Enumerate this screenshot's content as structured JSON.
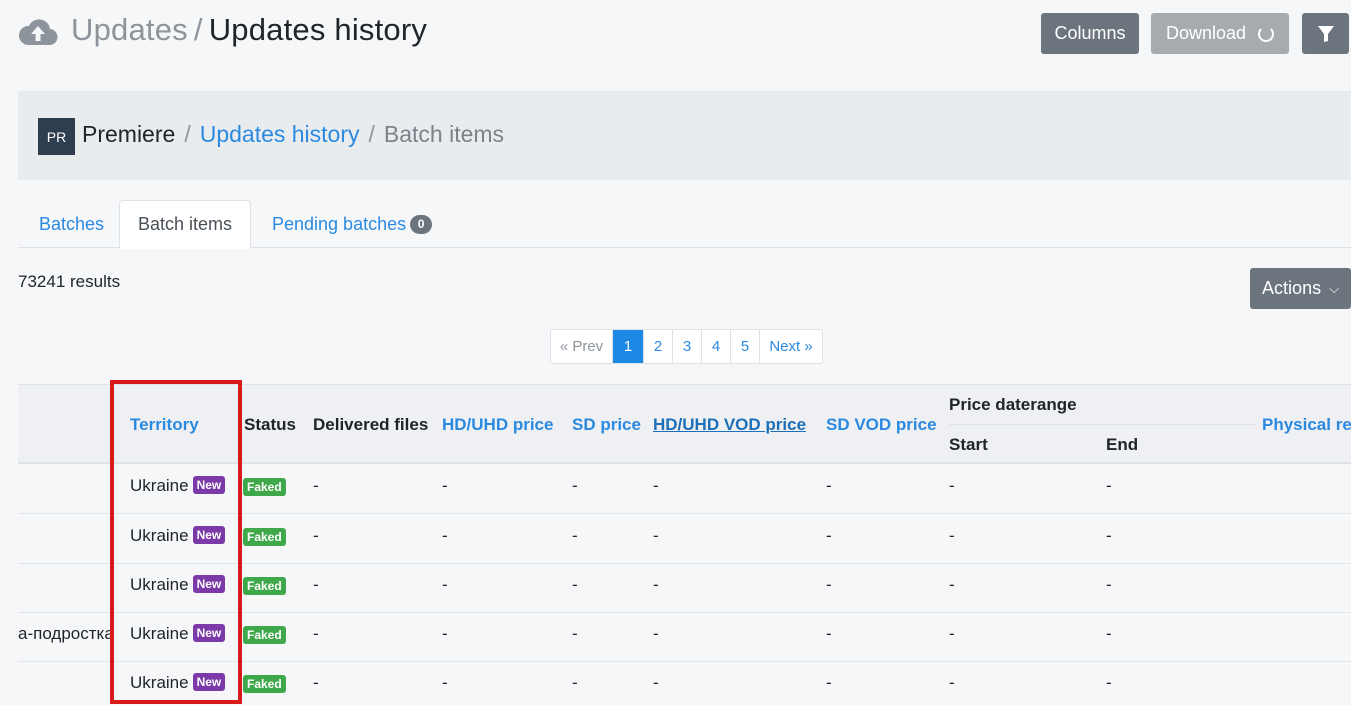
{
  "header": {
    "icon": "cloud-upload-icon",
    "title_parent": "Updates",
    "title_sep": "/",
    "title_current": "Updates history",
    "buttons": {
      "columns": "Columns",
      "download": "Download",
      "filter_icon": "filter-icon"
    }
  },
  "breadcrumb": {
    "badge": "PR",
    "items": [
      "Premiere",
      "Updates history",
      "Batch items"
    ],
    "sep": "/"
  },
  "tabs": [
    {
      "label": "Batches"
    },
    {
      "label": "Batch items",
      "active": true
    },
    {
      "label": "Pending batches",
      "count": "0"
    }
  ],
  "results_text": "73241 results",
  "actions_label": "Actions",
  "pagination": {
    "prev": "« Prev",
    "pages": [
      "1",
      "2",
      "3",
      "4",
      "5"
    ],
    "active": "1",
    "next": "Next »"
  },
  "table": {
    "headers": {
      "territory": "Territory",
      "status": "Status",
      "delivered_files": "Delivered files",
      "hd_uhd_price": "HD/UHD price",
      "sd_price": "SD price",
      "hd_uhd_vod_price": "HD/UHD VOD price",
      "sd_vod_price": "SD VOD price",
      "price_daterange": "Price daterange",
      "start": "Start",
      "end": "End",
      "physical": "Physical rel"
    },
    "rows": [
      {
        "title": "",
        "territory": "Ukraine",
        "territory_badge": "New",
        "status": "Faked",
        "delivered": "-",
        "hd": "-",
        "sd": "-",
        "hdvod": "-",
        "sdvod": "-",
        "start": "-",
        "end": "-"
      },
      {
        "title": "",
        "territory": "Ukraine",
        "territory_badge": "New",
        "status": "Faked",
        "delivered": "-",
        "hd": "-",
        "sd": "-",
        "hdvod": "-",
        "sdvod": "-",
        "start": "-",
        "end": "-"
      },
      {
        "title": "",
        "territory": "Ukraine",
        "territory_badge": "New",
        "status": "Faked",
        "delivered": "-",
        "hd": "-",
        "sd": "-",
        "hdvod": "-",
        "sdvod": "-",
        "start": "-",
        "end": "-"
      },
      {
        "title": "а-подростка",
        "territory": "Ukraine",
        "territory_badge": "New",
        "status": "Faked",
        "delivered": "-",
        "hd": "-",
        "sd": "-",
        "hdvod": "-",
        "sdvod": "-",
        "start": "-",
        "end": "-"
      },
      {
        "title": "",
        "territory": "Ukraine",
        "territory_badge": "New",
        "status": "Faked",
        "delivered": "-",
        "hd": "-",
        "sd": "-",
        "hdvod": "-",
        "sdvod": "-",
        "start": "-",
        "end": "-"
      }
    ]
  },
  "colors": {
    "link": "#2b8ae0",
    "new_badge": "#7b3aa8",
    "faked_badge": "#3fa84a",
    "highlight": "#d91a1a"
  }
}
